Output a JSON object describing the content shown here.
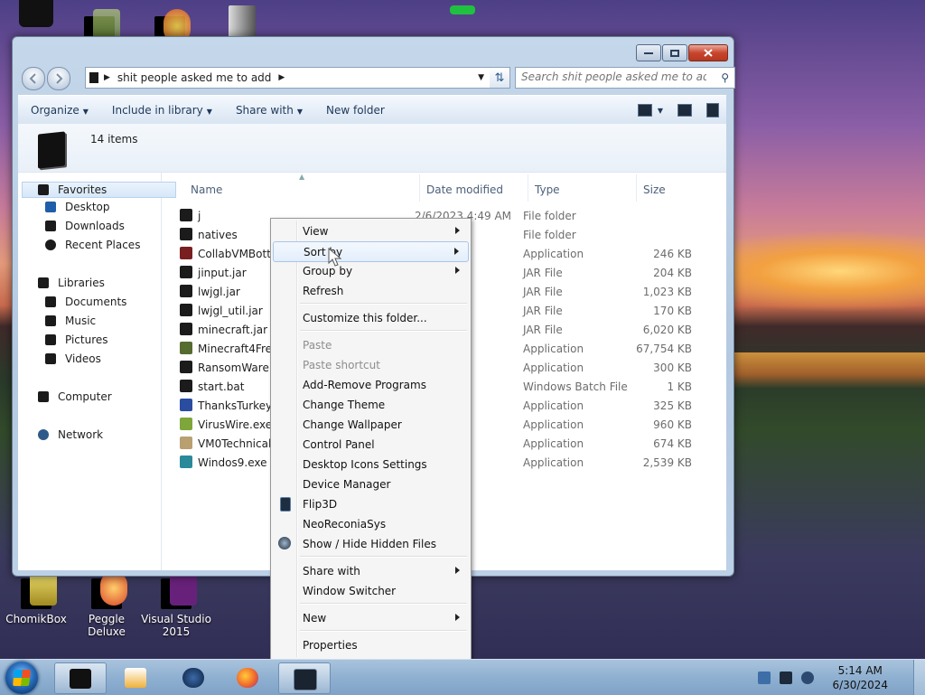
{
  "window": {
    "breadcrumb_folder": "shit people asked me to add",
    "search_placeholder": "Search shit people asked me to add",
    "item_count": "14 items"
  },
  "toolbar": {
    "organize": "Organize",
    "include_in_library": "Include in library",
    "share_with": "Share with",
    "new_folder": "New folder"
  },
  "navpane": {
    "favorites": "Favorites",
    "desktop": "Desktop",
    "downloads": "Downloads",
    "recent_places": "Recent Places",
    "libraries": "Libraries",
    "documents": "Documents",
    "music": "Music",
    "pictures": "Pictures",
    "videos": "Videos",
    "computer": "Computer",
    "network": "Network"
  },
  "columns": {
    "name": "Name",
    "date": "Date modified",
    "type": "Type",
    "size": "Size"
  },
  "files": [
    {
      "name": "j",
      "date": "2/6/2023 4:49 AM",
      "type": "File folder",
      "size": ""
    },
    {
      "name": "natives",
      "date": "16 AM",
      "type": "File folder",
      "size": ""
    },
    {
      "name": "CollabVMBotte",
      "date": "0 AM",
      "type": "Application",
      "size": "246 KB"
    },
    {
      "name": "jinput.jar",
      "date": "34 AM",
      "type": "JAR File",
      "size": "204 KB"
    },
    {
      "name": "lwjgl.jar",
      "date": "05 AM",
      "type": "JAR File",
      "size": "1,023 KB"
    },
    {
      "name": "lwjgl_util.jar",
      "date": "34 AM",
      "type": "JAR File",
      "size": "170 KB"
    },
    {
      "name": "minecraft.jar",
      "date": "48 AM",
      "type": "JAR File",
      "size": "6,020 KB"
    },
    {
      "name": "Minecraft4Free",
      "date": "0 AM",
      "type": "Application",
      "size": "67,754 KB"
    },
    {
      "name": "RansomWareBu",
      "date": "6 AM",
      "type": "Application",
      "size": "300 KB"
    },
    {
      "name": "start.bat",
      "date": "49 AM",
      "type": "Windows Batch File",
      "size": "1 KB"
    },
    {
      "name": "ThanksTurkey.e",
      "date": "7 PM",
      "type": "Application",
      "size": "325 KB"
    },
    {
      "name": "VirusWire.exe",
      "date": "1 AM",
      "type": "Application",
      "size": "960 KB"
    },
    {
      "name": "VM0TechnicalS",
      "date": "3 AM",
      "type": "Application",
      "size": "674 KB"
    },
    {
      "name": "Windos9.exe",
      "date": "6 AM",
      "type": "Application",
      "size": "2,539 KB"
    }
  ],
  "context_menu": [
    {
      "label": "View",
      "submenu": true
    },
    {
      "label": "Sort by",
      "submenu": true
    },
    {
      "label": "Group by",
      "submenu": true
    },
    {
      "label": "Refresh"
    },
    {
      "label": "Customize this folder..."
    },
    {
      "label": "Paste",
      "disabled": true
    },
    {
      "label": "Paste shortcut",
      "disabled": true
    },
    {
      "label": "Add-Remove Programs"
    },
    {
      "label": "Change Theme"
    },
    {
      "label": "Change Wallpaper"
    },
    {
      "label": "Control Panel"
    },
    {
      "label": "Desktop Icons Settings"
    },
    {
      "label": "Device Manager"
    },
    {
      "label": "Flip3D"
    },
    {
      "label": "NeoReconiaSys"
    },
    {
      "label": "Show / Hide Hidden Files"
    },
    {
      "label": "Share with",
      "submenu": true
    },
    {
      "label": "Window Switcher"
    },
    {
      "label": "New",
      "submenu": true
    },
    {
      "label": "Properties"
    }
  ],
  "desktop_icons": [
    {
      "label": "ChomikBox"
    },
    {
      "label": "Peggle Deluxe"
    },
    {
      "label": "Visual Studio 2015"
    }
  ],
  "taskbar": {
    "time": "5:14 AM",
    "date": "6/30/2024"
  },
  "colors": {
    "accent": "#2d5a8e",
    "title_bar": "#b4c9e0",
    "close_button": "#c9452d"
  },
  "icons": [
    "back-icon",
    "forward-icon",
    "folder-icon",
    "refresh-icon",
    "search-icon",
    "windows-start-icon"
  ]
}
